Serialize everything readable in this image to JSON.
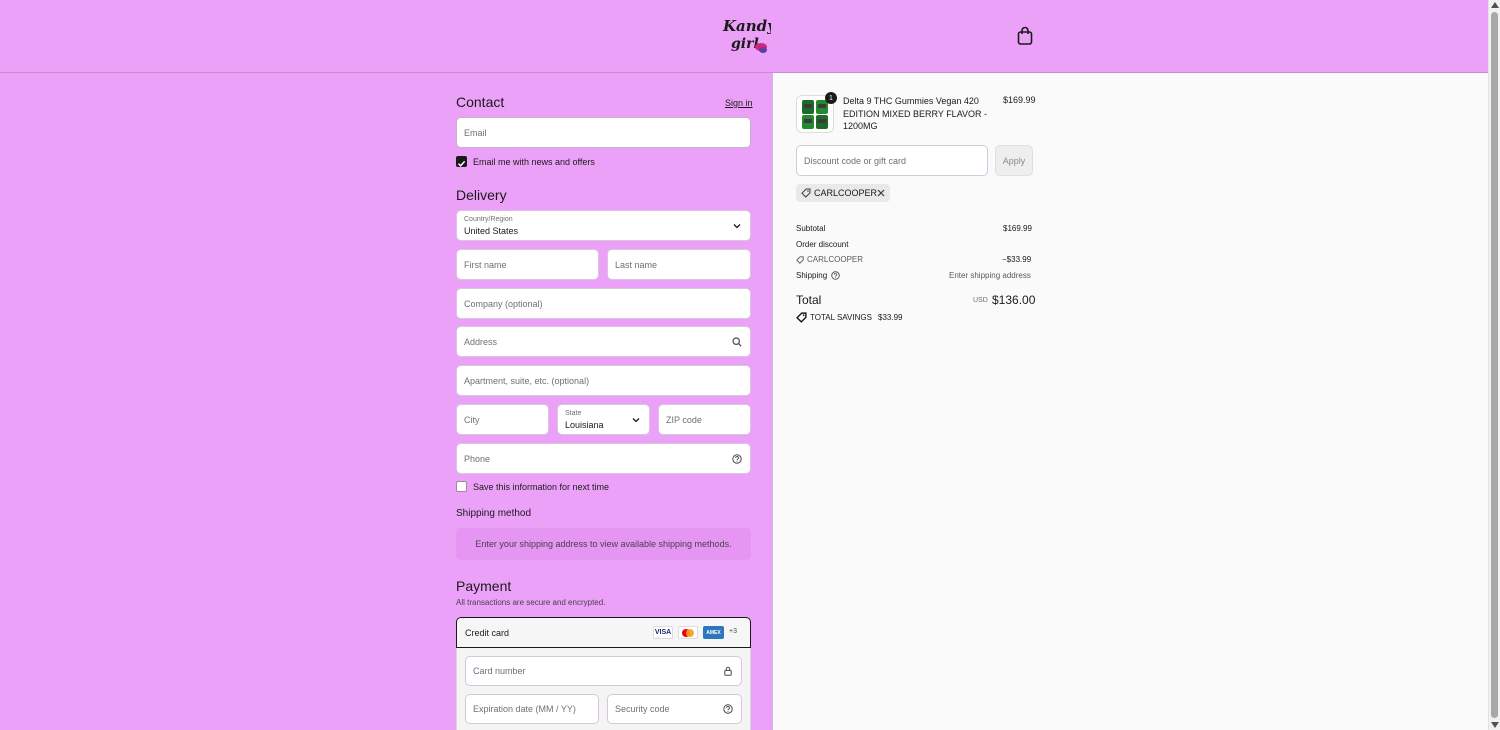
{
  "header": {
    "logo_alt": "Kandy Girl",
    "cart_icon": "shopping-bag-icon"
  },
  "contact": {
    "heading": "Contact",
    "sign_in": "Sign in",
    "email_placeholder": "Email",
    "news_label": "Email me with news and offers",
    "news_checked": true
  },
  "delivery": {
    "heading": "Delivery",
    "country_label": "Country/Region",
    "country_value": "United States",
    "first_name": "First name",
    "last_name": "Last name",
    "company": "Company (optional)",
    "address": "Address",
    "apartment": "Apartment, suite, etc. (optional)",
    "city": "City",
    "state_label": "State",
    "state_value": "Louisiana",
    "zip": "ZIP code",
    "phone": "Phone",
    "save_label": "Save this information for next time",
    "save_checked": false
  },
  "shipping_method": {
    "heading": "Shipping method",
    "message": "Enter your shipping address to view available shipping methods."
  },
  "payment": {
    "heading": "Payment",
    "subtitle": "All transactions are secure and encrypted.",
    "method_label": "Credit card",
    "card_brands": [
      "VISA",
      "Mastercard",
      "AMEX"
    ],
    "more_brands": "+3",
    "card_number": "Card number",
    "expiry": "Expiration date (MM / YY)",
    "security": "Security code"
  },
  "summary": {
    "item": {
      "quantity": "1",
      "name": "Delta 9 THC Gummies Vegan 420 EDITION MIXED BERRY FLAVOR - 1200MG",
      "price": "$169.99"
    },
    "discount_placeholder": "Discount code or gift card",
    "apply_label": "Apply",
    "applied_code": "CARLCOOPER",
    "subtotal_label": "Subtotal",
    "subtotal_value": "$169.99",
    "order_discount_label": "Order discount",
    "discount_code": "CARLCOOPER",
    "discount_value": "−$33.99",
    "shipping_label": "Shipping",
    "shipping_value": "Enter shipping address",
    "total_label": "Total",
    "currency": "USD",
    "total_value": "$136.00",
    "savings_label": "TOTAL SAVINGS",
    "savings_value": "$33.99"
  },
  "colors": {
    "brand_pink": "#eca1f8",
    "ship_box": "#e595f2",
    "summary_bg": "#fafafa"
  }
}
